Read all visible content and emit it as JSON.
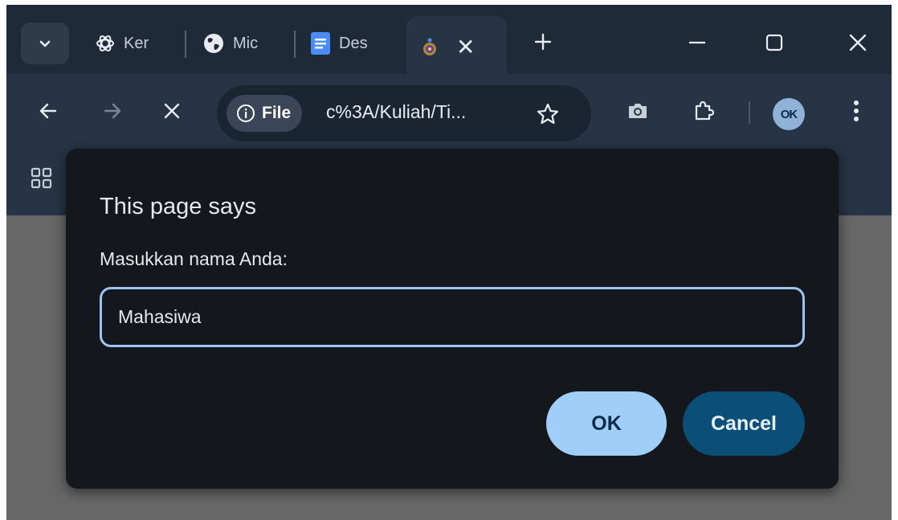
{
  "tabs": [
    {
      "label": "Ker",
      "icon": "openai-icon"
    },
    {
      "label": "Mic",
      "icon": "globe-icon"
    },
    {
      "label": "Des",
      "icon": "docs-icon"
    },
    {
      "label": "",
      "icon": "site-favicon",
      "active": true
    }
  ],
  "toolbar": {
    "site_chip_label": "File",
    "url": "c%3A/Kuliah/Ti...",
    "profile_initials": "OK"
  },
  "dialog": {
    "title": "This page says",
    "message": "Masukkan nama Anda:",
    "input_value": "Mahasiwa",
    "ok_label": "OK",
    "cancel_label": "Cancel"
  },
  "colors": {
    "frame": "#1f2a38",
    "toolbar": "#263445",
    "dialog_bg": "#14171c",
    "input_border": "#9cc4f0",
    "ok_button": "#9fcff8",
    "cancel_button": "#0b4f78",
    "page_content": "#676767"
  }
}
